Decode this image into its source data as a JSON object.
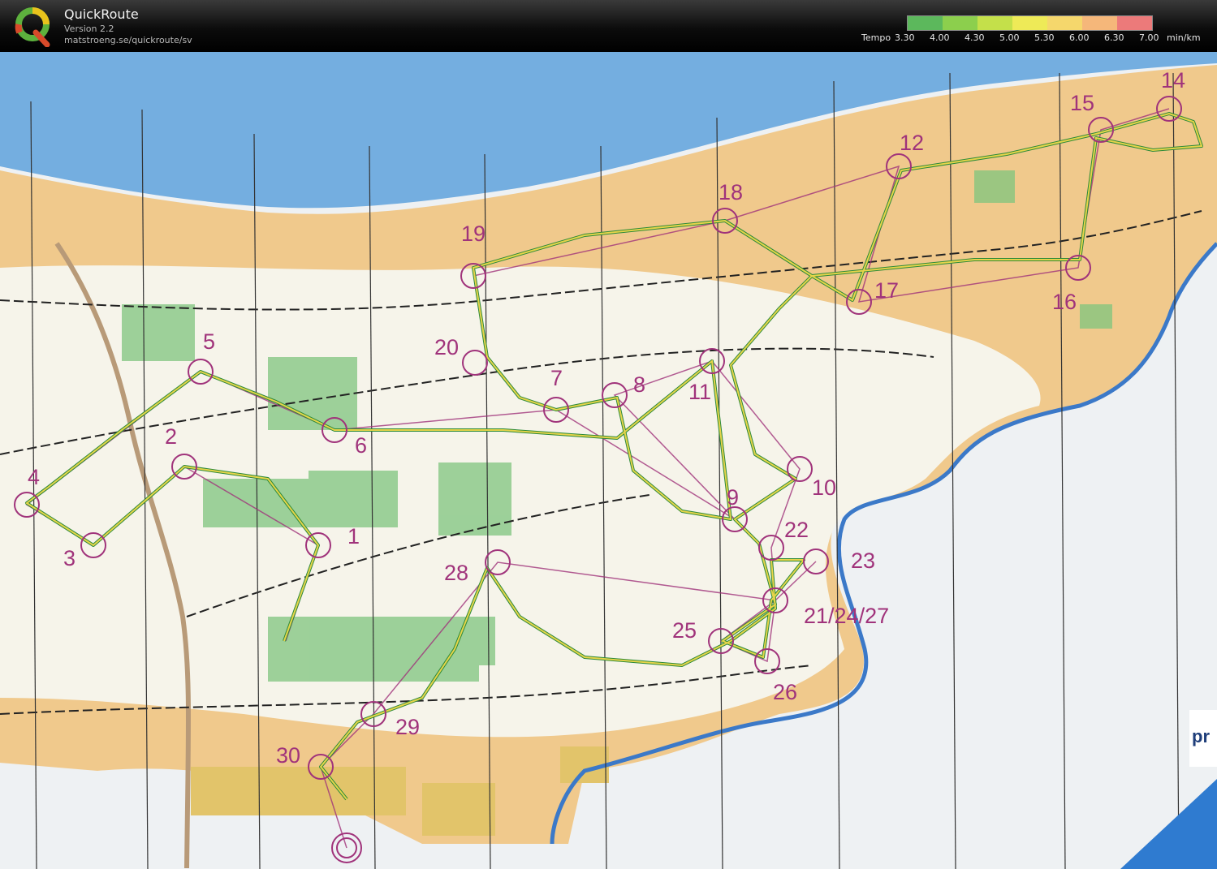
{
  "app": {
    "name": "QuickRoute",
    "version": "Version 2.2",
    "url": "matstroeng.se/quickroute/sv"
  },
  "pace_legend": {
    "label": "Tempo",
    "unit": "min/km",
    "ticks": [
      "3.30",
      "4.00",
      "4.30",
      "5.00",
      "5.30",
      "6.00",
      "6.30",
      "7.00"
    ],
    "colors": [
      "#5cb85c",
      "#8ccf4d",
      "#c4e04a",
      "#eeea57",
      "#f5d76c",
      "#f5b77a",
      "#f29a7a",
      "#ec7a7a"
    ]
  },
  "map": {
    "control_labels": [
      "1",
      "2",
      "3",
      "4",
      "5",
      "6",
      "7",
      "8",
      "9",
      "10",
      "11",
      "12",
      "14",
      "15",
      "16",
      "17",
      "18",
      "19",
      "20",
      "21/24/27",
      "22",
      "23",
      "25",
      "26",
      "28",
      "29",
      "30"
    ],
    "sponsor_text": "pr"
  }
}
